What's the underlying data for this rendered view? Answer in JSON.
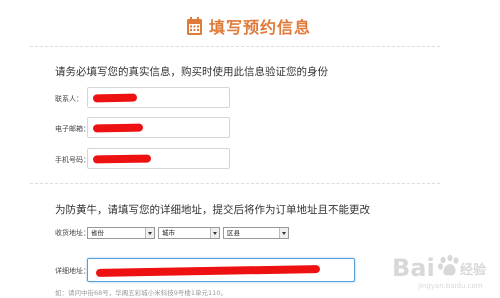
{
  "header": {
    "title": "填写预约信息",
    "icon": "calendar-icon",
    "accent_color": "#e07a3a"
  },
  "contact_section": {
    "note": "请务必填写您的真实信息，购买时使用此信息验证您的身份",
    "fields": [
      {
        "label": "联系人：",
        "value_redacted": true
      },
      {
        "label": "电子邮箱：",
        "value_redacted": true
      },
      {
        "label": "手机号码：",
        "value_redacted": true
      }
    ]
  },
  "address_section": {
    "note": "为防黄牛，请填写您的详细地址，提交后将作为订单地址且不能更改",
    "region_label": "收货地址：",
    "province": "省份",
    "city": "城市",
    "district": "区县",
    "detail_label": "详细地址：",
    "detail_redacted": true,
    "hint": "如：请问中街68号，华阁五彩城小米科技9号楼1单元110。",
    "focus_color": "#5a9fd6"
  },
  "redaction_color": "#ee1111",
  "watermark": {
    "brand": "Bai",
    "brand_suffix": "经验",
    "sub": "jingyan.baidu.com"
  }
}
